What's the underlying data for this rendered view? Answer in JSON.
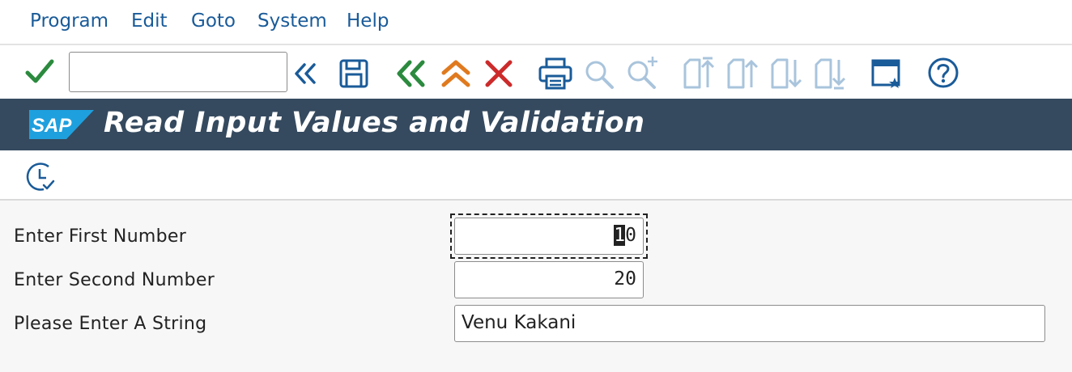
{
  "menu": {
    "items": [
      "Program",
      "Edit",
      "Goto",
      "System",
      "Help"
    ]
  },
  "toolbar": {
    "command_field_value": "",
    "icons": [
      "enter-check-icon",
      "expand-left-icon",
      "save-icon",
      "back-icon",
      "exit-icon",
      "cancel-icon",
      "print-icon",
      "find-icon",
      "find-next-icon",
      "first-page-icon",
      "previous-page-icon",
      "next-page-icon",
      "last-page-icon",
      "new-session-icon",
      "help-icon"
    ]
  },
  "title": {
    "logo_text": "SAP",
    "text": "Read Input Values and Validation"
  },
  "app_toolbar": {
    "icons": [
      "execute-clock-icon"
    ]
  },
  "form": {
    "first_number": {
      "label": "Enter First Number",
      "value_head": "1",
      "value_tail": "0"
    },
    "second_number": {
      "label": "Enter Second Number",
      "value": "20"
    },
    "string": {
      "label": "Please Enter A String",
      "value": "Venu Kakani"
    }
  },
  "colors": {
    "menu_text": "#1a5b99",
    "title_bar": "#354a5f",
    "enter_green": "#2b8a3e",
    "back_green": "#2b8a3e",
    "exit_orange": "#e07a1f",
    "cancel_red": "#cc2b2b",
    "icon_blue": "#1a5b99",
    "disabled_icon": "#a9c4dc",
    "sap_logo_blue": "#1fa0de"
  }
}
